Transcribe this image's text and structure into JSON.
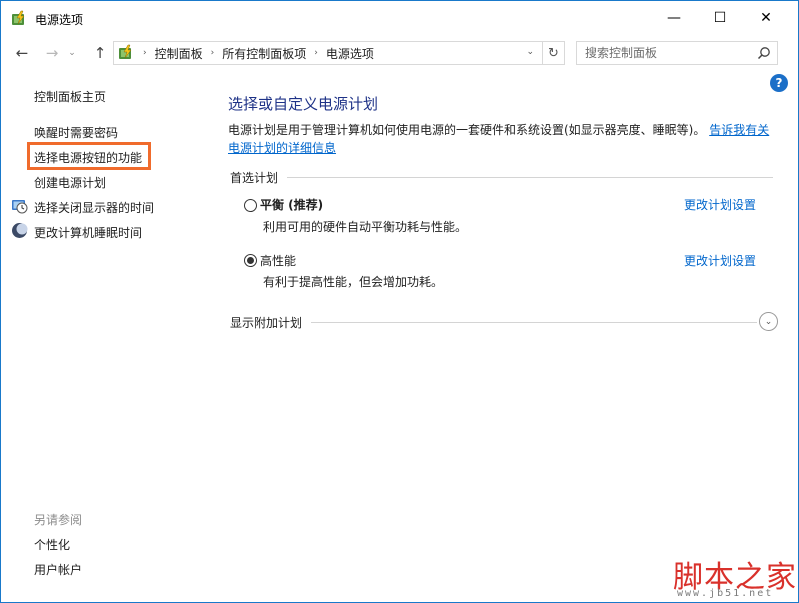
{
  "window": {
    "title": "电源选项",
    "min": "—",
    "max": "☐",
    "close": "✕"
  },
  "nav": {
    "back": "←",
    "forward": "→",
    "recent": "⌄",
    "up": "↑",
    "breadcrumbs": [
      "控制面板",
      "所有控制面板项",
      "电源选项"
    ],
    "sep": "›",
    "dropdown": "⌄",
    "refresh": "↻"
  },
  "search": {
    "placeholder": "搜索控制面板"
  },
  "help": "?",
  "left": {
    "home": "控制面板主页",
    "links": [
      "唤醒时需要密码",
      "选择电源按钮的功能",
      "创建电源计划",
      "选择关闭显示器的时间",
      "更改计算机睡眠时间"
    ],
    "see_also": "另请参阅",
    "see_also_links": [
      "个性化",
      "用户帐户"
    ]
  },
  "main": {
    "title": "选择或自定义电源计划",
    "desc": "电源计划是用于管理计算机如何使用电源的一套硬件和系统设置(如显示器亮度、睡眠等)。",
    "desc_link": "告诉我有关电源计划的详细信息",
    "preferred": "首选计划",
    "plans": [
      {
        "name": "平衡 (推荐)",
        "desc": "利用可用的硬件自动平衡功耗与性能。",
        "link": "更改计划设置",
        "selected": false
      },
      {
        "name": "高性能",
        "desc": "有利于提高性能，但会增加功耗。",
        "link": "更改计划设置",
        "selected": true
      }
    ],
    "more": "显示附加计划",
    "expand": "⌄"
  },
  "watermark": {
    "main": "脚本之家",
    "sub": "www.jb51.net"
  },
  "colors": {
    "accent": "#1979ca",
    "highlight": "#f06b2c",
    "title": "#1e3287",
    "link": "#0066cc"
  }
}
